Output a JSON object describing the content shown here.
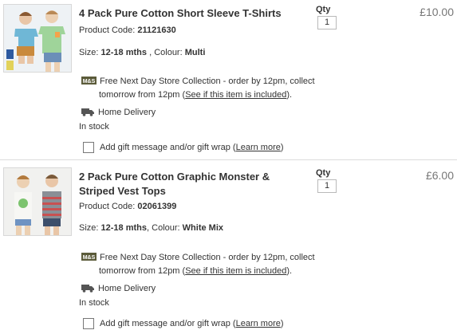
{
  "items": [
    {
      "title": "4 Pack Pure Cotton Short Sleeve T-Shirts",
      "code_label": "Product Code:",
      "code": "21121630",
      "size_label": "Size:",
      "size": "12-18 mths",
      "colour_label": ", Colour:",
      "colour": "Multi",
      "store_text": "Free Next Day Store Collection - order by 12pm, collect",
      "store_text2": "tomorrow  from 12pm (",
      "store_link": "See if this item is included",
      "store_text3": ").",
      "delivery": "Home Delivery",
      "stock": "In stock",
      "gift_text": "Add gift message and/or gift wrap (",
      "gift_link": "Learn more",
      "gift_close": ")",
      "qty_label": "Qty",
      "qty": "1",
      "price": "£10.00"
    },
    {
      "title": "2 Pack Pure Cotton Graphic Monster & Striped Vest Tops",
      "code_label": "Product Code:",
      "code": "02061399",
      "size_label": "Size:",
      "size": "12-18 mths",
      "colour_label": ", Colour:",
      "colour": "White Mix",
      "store_text": "Free Next Day Store Collection - order by 12pm, collect",
      "store_text2": "tomorrow  from 12pm (",
      "store_link": "See if this item is included",
      "store_text3": ").",
      "delivery": "Home Delivery",
      "stock": "In stock",
      "gift_text": "Add gift message and/or gift wrap (",
      "gift_link": "Learn more",
      "gift_close": ")",
      "qty_label": "Qty",
      "qty": "1",
      "price": "£6.00"
    }
  ],
  "store_badge": "M&S",
  "colors": {
    "text": "#333333",
    "price": "#777777",
    "divider": "#dcdcdc",
    "badge": "#5b5b3a"
  }
}
